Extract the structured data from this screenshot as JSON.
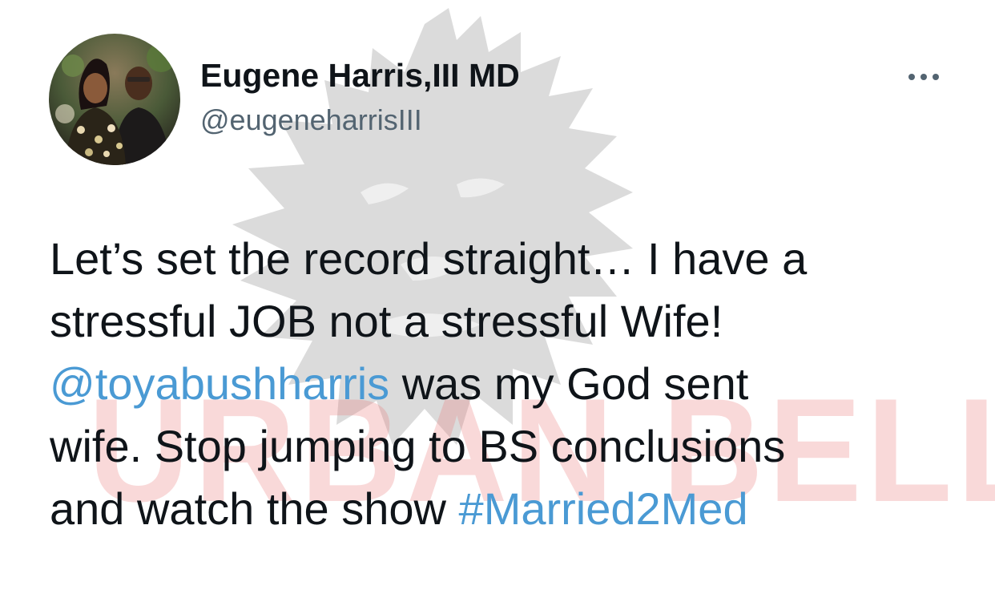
{
  "author": {
    "display_name": "Eugene Harris,III MD",
    "handle": "@eugeneharrisIII"
  },
  "tweet": {
    "line1": "Let’s set the record straight… I have a",
    "line2": "stressful JOB not a stressful Wife!",
    "mention": "@toyabushharris",
    "line3_rest": " was my God sent",
    "line4": "wife. Stop jumping to BS conclusions",
    "line5_start": "and watch the show ",
    "hashtag": "#Married2Med"
  },
  "watermark": {
    "text": "URBAN BELLE",
    "logo": "lion-head-watermark"
  },
  "icons": {
    "more": "more-horizontal-icon",
    "avatar": "profile-photo"
  },
  "colors": {
    "text": "#0f1419",
    "secondary": "#536471",
    "link": "#4a9ad4",
    "watermark_text": "#eb7878",
    "watermark_logo": "#cfcfcf"
  }
}
